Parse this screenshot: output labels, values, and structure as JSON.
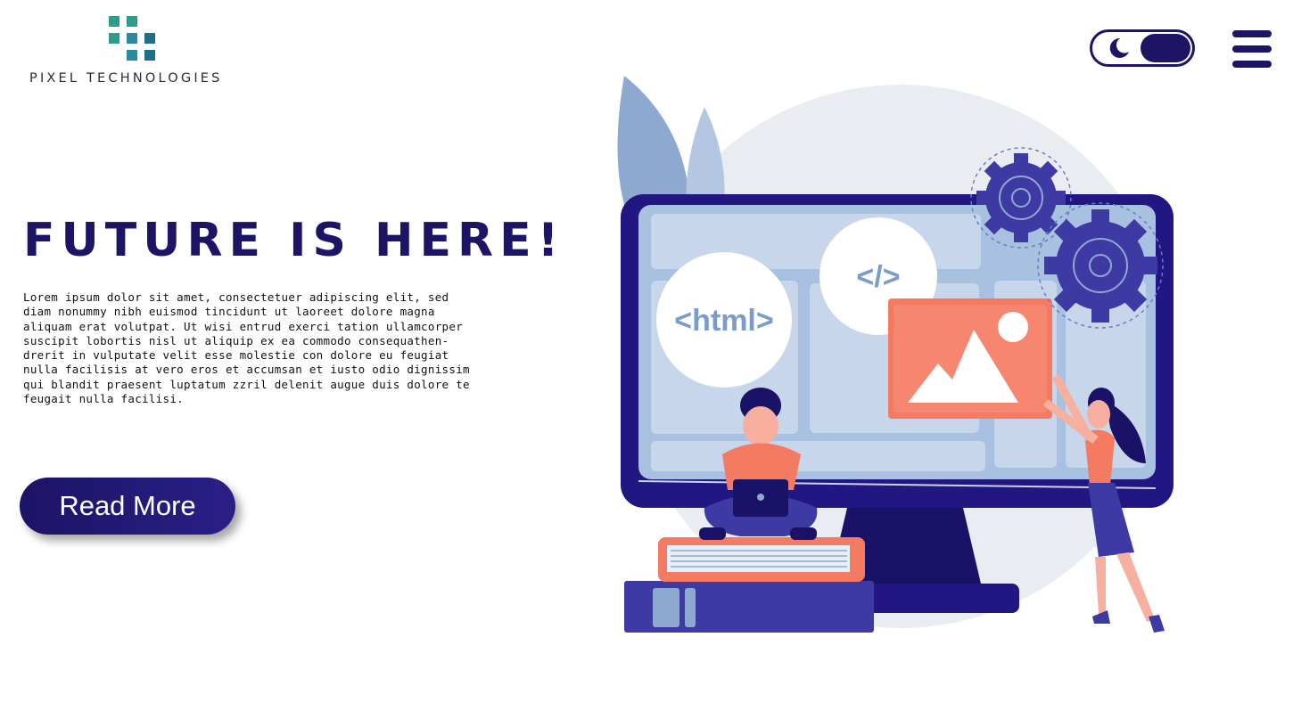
{
  "brand": {
    "name": "PIXEL TECHNOLOGIES",
    "colors": [
      "#2f9c8a",
      "#2a8aa0",
      "#1f6f8c"
    ]
  },
  "header": {
    "theme_toggle": {
      "icon": "moon-icon",
      "state": "dark"
    },
    "menu_icon": "hamburger-menu-icon"
  },
  "hero": {
    "title": "FUTURE IS HERE!",
    "body": "Lorem ipsum dolor sit amet, consectetuer adipiscing elit, sed diam nonummy nibh euismod tincidunt ut laoreet dolore magna aliquam erat volutpat. Ut wisi entrud exerci tation ullamcorper suscipit lobortis nisl ut aliquip ex ea commodo consequathen-drerit in vulputate velit esse molestie con dolore eu feugiat nulla facilisis at vero eros et accumsan et iusto odio dignissim qui blandit praesent luptatum zzril delenit augue duis dolore te feugait nulla facilisi.",
    "cta_label": "Read More"
  },
  "illustration": {
    "html_badge": "<html>",
    "code_badge": "</>"
  },
  "colors": {
    "primary": "#1e1466",
    "accent": "#f47a62",
    "screen": "#a9c1e0"
  }
}
